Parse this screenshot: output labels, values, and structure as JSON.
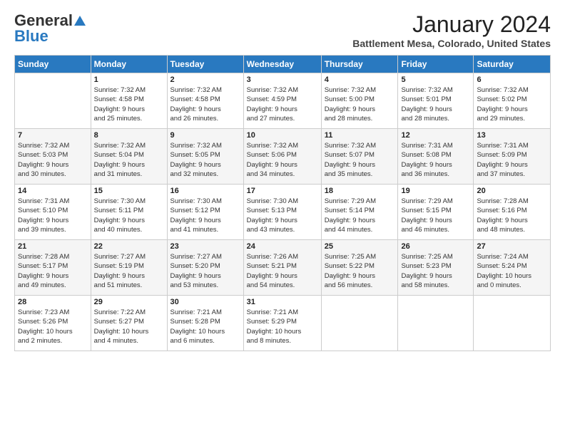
{
  "logo": {
    "line1": "General",
    "line2": "Blue"
  },
  "header": {
    "month": "January 2024",
    "location": "Battlement Mesa, Colorado, United States"
  },
  "days_of_week": [
    "Sunday",
    "Monday",
    "Tuesday",
    "Wednesday",
    "Thursday",
    "Friday",
    "Saturday"
  ],
  "weeks": [
    [
      {
        "day": "",
        "info": ""
      },
      {
        "day": "1",
        "info": "Sunrise: 7:32 AM\nSunset: 4:58 PM\nDaylight: 9 hours\nand 25 minutes."
      },
      {
        "day": "2",
        "info": "Sunrise: 7:32 AM\nSunset: 4:58 PM\nDaylight: 9 hours\nand 26 minutes."
      },
      {
        "day": "3",
        "info": "Sunrise: 7:32 AM\nSunset: 4:59 PM\nDaylight: 9 hours\nand 27 minutes."
      },
      {
        "day": "4",
        "info": "Sunrise: 7:32 AM\nSunset: 5:00 PM\nDaylight: 9 hours\nand 28 minutes."
      },
      {
        "day": "5",
        "info": "Sunrise: 7:32 AM\nSunset: 5:01 PM\nDaylight: 9 hours\nand 28 minutes."
      },
      {
        "day": "6",
        "info": "Sunrise: 7:32 AM\nSunset: 5:02 PM\nDaylight: 9 hours\nand 29 minutes."
      }
    ],
    [
      {
        "day": "7",
        "info": "Sunrise: 7:32 AM\nSunset: 5:03 PM\nDaylight: 9 hours\nand 30 minutes."
      },
      {
        "day": "8",
        "info": "Sunrise: 7:32 AM\nSunset: 5:04 PM\nDaylight: 9 hours\nand 31 minutes."
      },
      {
        "day": "9",
        "info": "Sunrise: 7:32 AM\nSunset: 5:05 PM\nDaylight: 9 hours\nand 32 minutes."
      },
      {
        "day": "10",
        "info": "Sunrise: 7:32 AM\nSunset: 5:06 PM\nDaylight: 9 hours\nand 34 minutes."
      },
      {
        "day": "11",
        "info": "Sunrise: 7:32 AM\nSunset: 5:07 PM\nDaylight: 9 hours\nand 35 minutes."
      },
      {
        "day": "12",
        "info": "Sunrise: 7:31 AM\nSunset: 5:08 PM\nDaylight: 9 hours\nand 36 minutes."
      },
      {
        "day": "13",
        "info": "Sunrise: 7:31 AM\nSunset: 5:09 PM\nDaylight: 9 hours\nand 37 minutes."
      }
    ],
    [
      {
        "day": "14",
        "info": "Sunrise: 7:31 AM\nSunset: 5:10 PM\nDaylight: 9 hours\nand 39 minutes."
      },
      {
        "day": "15",
        "info": "Sunrise: 7:30 AM\nSunset: 5:11 PM\nDaylight: 9 hours\nand 40 minutes."
      },
      {
        "day": "16",
        "info": "Sunrise: 7:30 AM\nSunset: 5:12 PM\nDaylight: 9 hours\nand 41 minutes."
      },
      {
        "day": "17",
        "info": "Sunrise: 7:30 AM\nSunset: 5:13 PM\nDaylight: 9 hours\nand 43 minutes."
      },
      {
        "day": "18",
        "info": "Sunrise: 7:29 AM\nSunset: 5:14 PM\nDaylight: 9 hours\nand 44 minutes."
      },
      {
        "day": "19",
        "info": "Sunrise: 7:29 AM\nSunset: 5:15 PM\nDaylight: 9 hours\nand 46 minutes."
      },
      {
        "day": "20",
        "info": "Sunrise: 7:28 AM\nSunset: 5:16 PM\nDaylight: 9 hours\nand 48 minutes."
      }
    ],
    [
      {
        "day": "21",
        "info": "Sunrise: 7:28 AM\nSunset: 5:17 PM\nDaylight: 9 hours\nand 49 minutes."
      },
      {
        "day": "22",
        "info": "Sunrise: 7:27 AM\nSunset: 5:19 PM\nDaylight: 9 hours\nand 51 minutes."
      },
      {
        "day": "23",
        "info": "Sunrise: 7:27 AM\nSunset: 5:20 PM\nDaylight: 9 hours\nand 53 minutes."
      },
      {
        "day": "24",
        "info": "Sunrise: 7:26 AM\nSunset: 5:21 PM\nDaylight: 9 hours\nand 54 minutes."
      },
      {
        "day": "25",
        "info": "Sunrise: 7:25 AM\nSunset: 5:22 PM\nDaylight: 9 hours\nand 56 minutes."
      },
      {
        "day": "26",
        "info": "Sunrise: 7:25 AM\nSunset: 5:23 PM\nDaylight: 9 hours\nand 58 minutes."
      },
      {
        "day": "27",
        "info": "Sunrise: 7:24 AM\nSunset: 5:24 PM\nDaylight: 10 hours\nand 0 minutes."
      }
    ],
    [
      {
        "day": "28",
        "info": "Sunrise: 7:23 AM\nSunset: 5:26 PM\nDaylight: 10 hours\nand 2 minutes."
      },
      {
        "day": "29",
        "info": "Sunrise: 7:22 AM\nSunset: 5:27 PM\nDaylight: 10 hours\nand 4 minutes."
      },
      {
        "day": "30",
        "info": "Sunrise: 7:21 AM\nSunset: 5:28 PM\nDaylight: 10 hours\nand 6 minutes."
      },
      {
        "day": "31",
        "info": "Sunrise: 7:21 AM\nSunset: 5:29 PM\nDaylight: 10 hours\nand 8 minutes."
      },
      {
        "day": "",
        "info": ""
      },
      {
        "day": "",
        "info": ""
      },
      {
        "day": "",
        "info": ""
      }
    ]
  ]
}
